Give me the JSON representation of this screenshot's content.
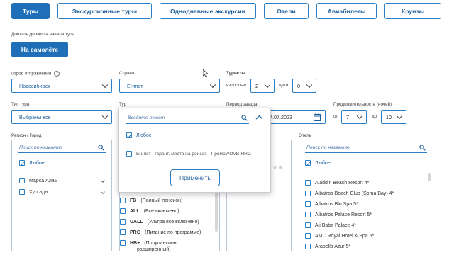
{
  "tabs": [
    "Туры",
    "Экскурсионные туры",
    "Однодневные экскурсии",
    "Отели",
    "Авиабилеты",
    "Круизы"
  ],
  "travel_method": {
    "caption": "Доехать до места начала тура",
    "button": "На самолёте"
  },
  "departure_city": {
    "label": "Город отправления",
    "value": "Новосибирск"
  },
  "country": {
    "label": "Страна",
    "value": "Египет"
  },
  "tourists": {
    "label": "Туристы",
    "adults_label": "взрослые",
    "adults": "2",
    "children_label": "дети",
    "children": "0"
  },
  "tour_type": {
    "label": "Тип тура",
    "value": "Выбраны все"
  },
  "tour": {
    "label": "Тур"
  },
  "check_in": {
    "label": "Период заезда",
    "value": "7.07.2023"
  },
  "duration": {
    "label": "Продолжительность (ночей)",
    "from_label": "от",
    "from": "7",
    "to_label": "до",
    "to": "10"
  },
  "region": {
    "label": "Регион / Город",
    "search_placeholder": "Поиск по названию",
    "any_label": "Любое",
    "items": [
      "Марса Алам",
      "Хургада"
    ]
  },
  "tour_popup": {
    "search_placeholder": "Введите текст",
    "any_label": "Любое",
    "items": [
      "Египет - гарант. места на рейсах - Промо7/OVB-HRG"
    ],
    "apply_label": "Применить"
  },
  "meals": {
    "items": [
      {
        "code": "FB",
        "desc": "(Полный пансион)"
      },
      {
        "code": "ALL",
        "desc": "(Все включено)"
      },
      {
        "code": "UALL",
        "desc": "(Ультра все включено)"
      },
      {
        "code": "PRG",
        "desc": "(Питание по программе)"
      },
      {
        "code": "HB+",
        "desc": "(Полупансион"
      }
    ],
    "last_line_2": "расширенный)"
  },
  "hotel": {
    "label": "Отель",
    "search_placeholder": "Поиск по названию",
    "any_label": "Любое",
    "items": [
      "Aladdin Beach Resort 4*",
      "Albatros Beach Club (Soma Bay) 4*",
      "Albatros Blu Spa 5*",
      "Albatros Palace Resort 5*",
      "Ali Baba Palace 4*",
      "AMC Royal Hotel & Spa 5*",
      "Arabella Azur 5*"
    ]
  },
  "colors": {
    "accent": "#1f6fb8",
    "border": "#2a7fc5",
    "text_blue": "#1f5f9e"
  },
  "icons": [
    "search-icon",
    "calendar-icon",
    "chevron-down-icon",
    "chevron-up-icon",
    "help-icon",
    "checkbox-icon",
    "star-icon"
  ]
}
